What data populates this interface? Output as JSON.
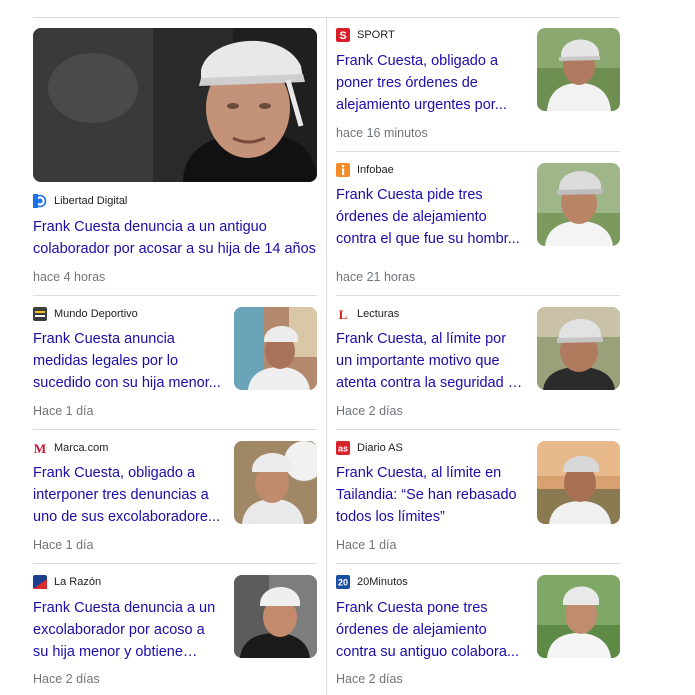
{
  "cards": [
    {
      "source": "Libertad Digital",
      "title": "Frank Cuesta denuncia a un antiguo colaborador por acosar a su hija de 14 años",
      "time": "hace 4 horas",
      "logo_icon": "libertad-digital-logo-icon",
      "logo_color": "#1a73e8",
      "photo": "frank-cuesta-large-photo"
    },
    {
      "source": "SPORT",
      "title": "Frank Cuesta, obligado a poner tres órdenes de alejamiento urgentes por...",
      "time": "hace 16 minutos",
      "logo_icon": "sport-logo-icon",
      "logo_color": "#d91e2a",
      "logo_text": "S",
      "photo": "frank-cuesta-thumbnail"
    },
    {
      "source": "Infobae",
      "title": "Frank Cuesta pide tres órdenes de alejamiento contra el que fue su hombr...",
      "time": "hace 21 horas",
      "logo_icon": "infobae-logo-icon",
      "logo_color": "#f28c28",
      "photo": "frank-cuesta-thumbnail"
    },
    {
      "source": "Mundo Deportivo",
      "title": "Frank Cuesta anuncia medidas legales por lo sucedido con su hija menor...",
      "time": "Hace 1 día",
      "logo_icon": "mundo-deportivo-logo-icon",
      "logo_color": "#3c3c3c",
      "photo": "frank-cuesta-thumbnail"
    },
    {
      "source": "Lecturas",
      "title": "Frank Cuesta, al límite por un importante motivo que atenta contra la seguridad de su...",
      "time": "Hace 2 días",
      "logo_icon": "lecturas-logo-icon",
      "logo_color": "#e02020",
      "logo_text": "L",
      "photo": "frank-cuesta-thumbnail"
    },
    {
      "source": "Marca.com",
      "title": "Frank Cuesta, obligado a interponer tres denuncias a uno de sus excolaboradore...",
      "time": "Hace 1 día",
      "logo_icon": "marca-logo-icon",
      "logo_color": "#c8102e",
      "logo_text": "M",
      "photo": "frank-cuesta-thumbnail"
    },
    {
      "source": "Diario AS",
      "title": "Frank Cuesta, al límite en Tailandia: “Se han rebasado todos los límites”",
      "time": "Hace 1 día",
      "logo_icon": "diario-as-logo-icon",
      "logo_color": "#d8232a",
      "logo_text": "as",
      "photo": "frank-cuesta-thumbnail"
    },
    {
      "source": "La Razón",
      "title": "Frank Cuesta denuncia a un excolaborador por acoso a su hija menor y obtiene tres...",
      "time": "Hace 2 días",
      "logo_icon": "la-razon-logo-icon",
      "logo_color": "#1d3f8f",
      "photo": "frank-cuesta-thumbnail"
    },
    {
      "source": "20Minutos",
      "title": "Frank Cuesta pone tres órdenes de alejamiento contra su antiguo colabora...",
      "time": "Hace 2 días",
      "logo_icon": "20minutos-logo-icon",
      "logo_color": "#1a4fa0",
      "logo_text": "20",
      "photo": "frank-cuesta-thumbnail"
    }
  ],
  "colors": {
    "link": "#1a0dab",
    "meta": "#70757a",
    "divider": "#dadce0"
  }
}
